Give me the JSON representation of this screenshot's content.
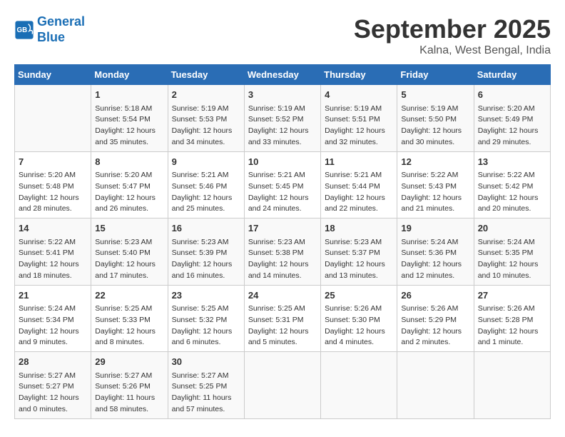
{
  "header": {
    "logo_line1": "General",
    "logo_line2": "Blue",
    "month": "September 2025",
    "location": "Kalna, West Bengal, India"
  },
  "weekdays": [
    "Sunday",
    "Monday",
    "Tuesday",
    "Wednesday",
    "Thursday",
    "Friday",
    "Saturday"
  ],
  "weeks": [
    [
      {
        "day": "",
        "info": ""
      },
      {
        "day": "1",
        "info": "Sunrise: 5:18 AM\nSunset: 5:54 PM\nDaylight: 12 hours\nand 35 minutes."
      },
      {
        "day": "2",
        "info": "Sunrise: 5:19 AM\nSunset: 5:53 PM\nDaylight: 12 hours\nand 34 minutes."
      },
      {
        "day": "3",
        "info": "Sunrise: 5:19 AM\nSunset: 5:52 PM\nDaylight: 12 hours\nand 33 minutes."
      },
      {
        "day": "4",
        "info": "Sunrise: 5:19 AM\nSunset: 5:51 PM\nDaylight: 12 hours\nand 32 minutes."
      },
      {
        "day": "5",
        "info": "Sunrise: 5:19 AM\nSunset: 5:50 PM\nDaylight: 12 hours\nand 30 minutes."
      },
      {
        "day": "6",
        "info": "Sunrise: 5:20 AM\nSunset: 5:49 PM\nDaylight: 12 hours\nand 29 minutes."
      }
    ],
    [
      {
        "day": "7",
        "info": "Sunrise: 5:20 AM\nSunset: 5:48 PM\nDaylight: 12 hours\nand 28 minutes."
      },
      {
        "day": "8",
        "info": "Sunrise: 5:20 AM\nSunset: 5:47 PM\nDaylight: 12 hours\nand 26 minutes."
      },
      {
        "day": "9",
        "info": "Sunrise: 5:21 AM\nSunset: 5:46 PM\nDaylight: 12 hours\nand 25 minutes."
      },
      {
        "day": "10",
        "info": "Sunrise: 5:21 AM\nSunset: 5:45 PM\nDaylight: 12 hours\nand 24 minutes."
      },
      {
        "day": "11",
        "info": "Sunrise: 5:21 AM\nSunset: 5:44 PM\nDaylight: 12 hours\nand 22 minutes."
      },
      {
        "day": "12",
        "info": "Sunrise: 5:22 AM\nSunset: 5:43 PM\nDaylight: 12 hours\nand 21 minutes."
      },
      {
        "day": "13",
        "info": "Sunrise: 5:22 AM\nSunset: 5:42 PM\nDaylight: 12 hours\nand 20 minutes."
      }
    ],
    [
      {
        "day": "14",
        "info": "Sunrise: 5:22 AM\nSunset: 5:41 PM\nDaylight: 12 hours\nand 18 minutes."
      },
      {
        "day": "15",
        "info": "Sunrise: 5:23 AM\nSunset: 5:40 PM\nDaylight: 12 hours\nand 17 minutes."
      },
      {
        "day": "16",
        "info": "Sunrise: 5:23 AM\nSunset: 5:39 PM\nDaylight: 12 hours\nand 16 minutes."
      },
      {
        "day": "17",
        "info": "Sunrise: 5:23 AM\nSunset: 5:38 PM\nDaylight: 12 hours\nand 14 minutes."
      },
      {
        "day": "18",
        "info": "Sunrise: 5:23 AM\nSunset: 5:37 PM\nDaylight: 12 hours\nand 13 minutes."
      },
      {
        "day": "19",
        "info": "Sunrise: 5:24 AM\nSunset: 5:36 PM\nDaylight: 12 hours\nand 12 minutes."
      },
      {
        "day": "20",
        "info": "Sunrise: 5:24 AM\nSunset: 5:35 PM\nDaylight: 12 hours\nand 10 minutes."
      }
    ],
    [
      {
        "day": "21",
        "info": "Sunrise: 5:24 AM\nSunset: 5:34 PM\nDaylight: 12 hours\nand 9 minutes."
      },
      {
        "day": "22",
        "info": "Sunrise: 5:25 AM\nSunset: 5:33 PM\nDaylight: 12 hours\nand 8 minutes."
      },
      {
        "day": "23",
        "info": "Sunrise: 5:25 AM\nSunset: 5:32 PM\nDaylight: 12 hours\nand 6 minutes."
      },
      {
        "day": "24",
        "info": "Sunrise: 5:25 AM\nSunset: 5:31 PM\nDaylight: 12 hours\nand 5 minutes."
      },
      {
        "day": "25",
        "info": "Sunrise: 5:26 AM\nSunset: 5:30 PM\nDaylight: 12 hours\nand 4 minutes."
      },
      {
        "day": "26",
        "info": "Sunrise: 5:26 AM\nSunset: 5:29 PM\nDaylight: 12 hours\nand 2 minutes."
      },
      {
        "day": "27",
        "info": "Sunrise: 5:26 AM\nSunset: 5:28 PM\nDaylight: 12 hours\nand 1 minute."
      }
    ],
    [
      {
        "day": "28",
        "info": "Sunrise: 5:27 AM\nSunset: 5:27 PM\nDaylight: 12 hours\nand 0 minutes."
      },
      {
        "day": "29",
        "info": "Sunrise: 5:27 AM\nSunset: 5:26 PM\nDaylight: 11 hours\nand 58 minutes."
      },
      {
        "day": "30",
        "info": "Sunrise: 5:27 AM\nSunset: 5:25 PM\nDaylight: 11 hours\nand 57 minutes."
      },
      {
        "day": "",
        "info": ""
      },
      {
        "day": "",
        "info": ""
      },
      {
        "day": "",
        "info": ""
      },
      {
        "day": "",
        "info": ""
      }
    ]
  ]
}
